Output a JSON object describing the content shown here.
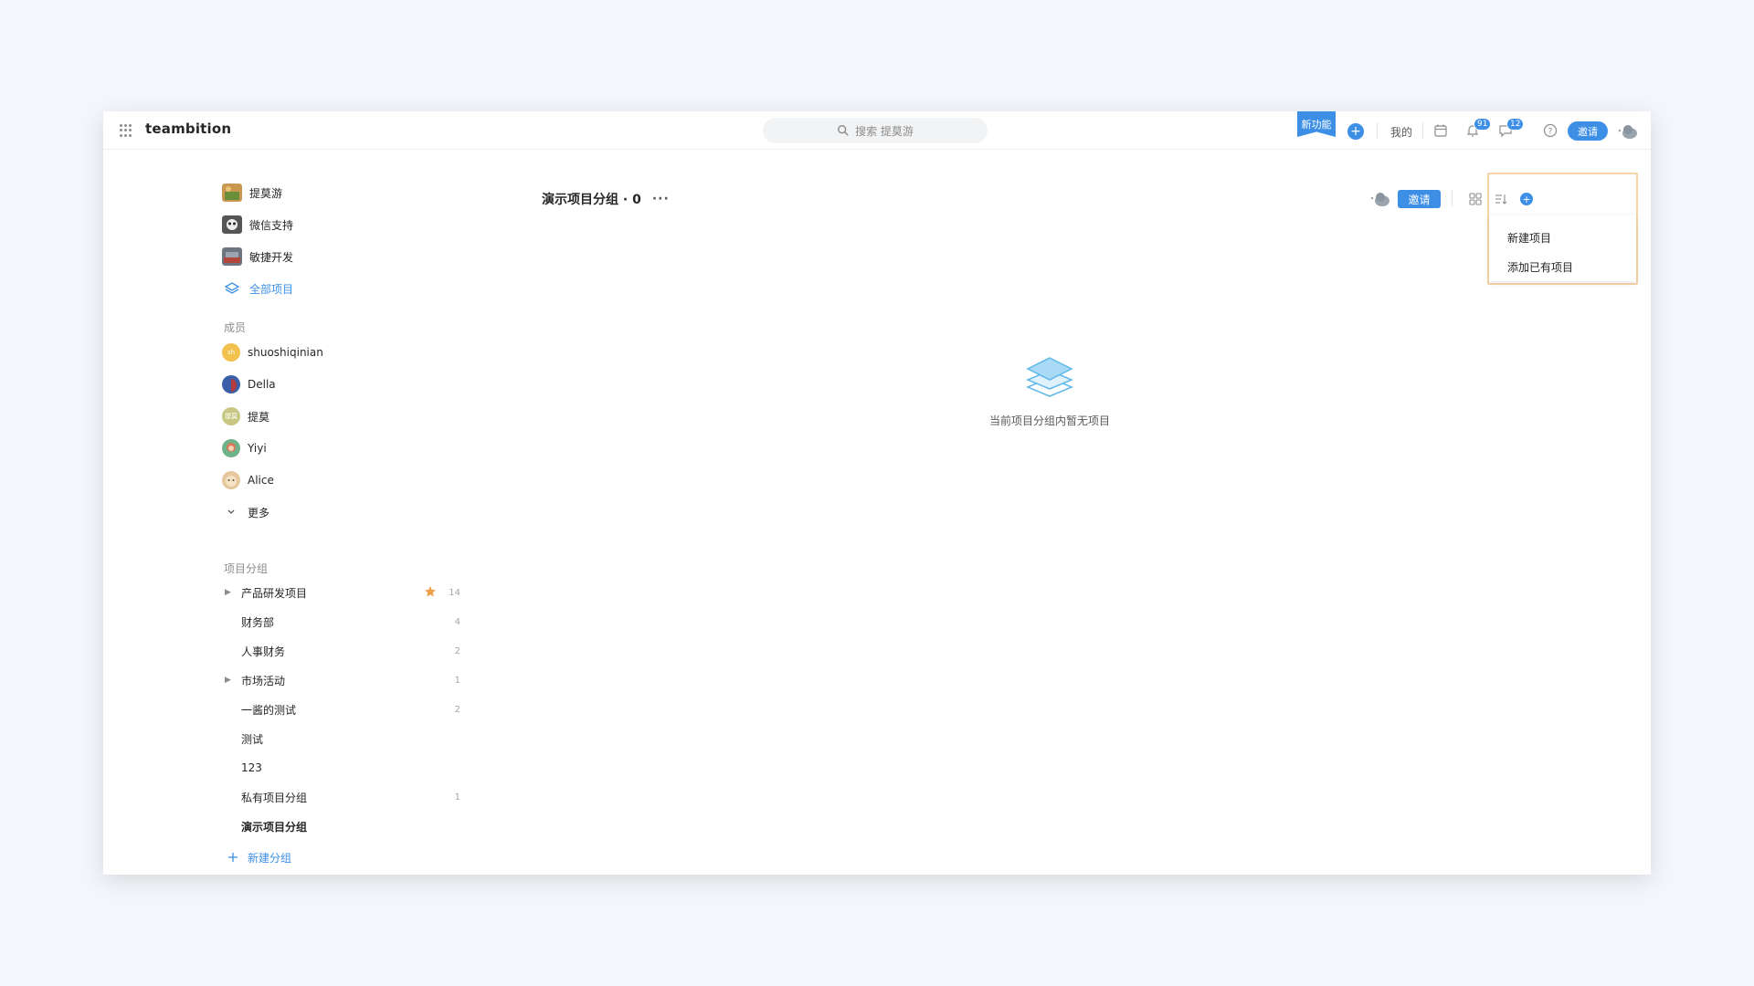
{
  "app": {
    "brand": "teambition",
    "search_placeholder": "搜索 提莫游",
    "new_feature": "新功能",
    "mine": "我的",
    "notification_count": "91",
    "message_count": "12",
    "invite": "邀请",
    "accent_color": "#3d8fe6"
  },
  "sidebar": {
    "projects": [
      {
        "label": "提莫游"
      },
      {
        "label": "微信支持"
      },
      {
        "label": "敏捷开发"
      }
    ],
    "all_projects": "全部项目",
    "members_title": "成员",
    "members": [
      {
        "name": "shuoshiqinian",
        "initials": "sh"
      },
      {
        "name": "Della"
      },
      {
        "name": "提莫",
        "initials": "提莫"
      },
      {
        "name": "Yiyi"
      },
      {
        "name": "Alice"
      }
    ],
    "more": "更多",
    "groups_title": "项目分组",
    "groups": [
      {
        "label": "产品研发项目",
        "count": "14"
      },
      {
        "label": "财务部",
        "count": "4"
      },
      {
        "label": "人事财务",
        "count": "2"
      },
      {
        "label": "市场活动",
        "count": "1"
      },
      {
        "label": "一酱的测试",
        "count": "2"
      },
      {
        "label": "测试",
        "count": ""
      },
      {
        "label": "123",
        "count": ""
      },
      {
        "label": "私有项目分组",
        "count": "1"
      },
      {
        "label": "演示项目分组",
        "count": ""
      }
    ],
    "new_group": "新建分组"
  },
  "main": {
    "title": "演示项目分组 · 0",
    "more": "···",
    "invite": "邀请",
    "dropdown": {
      "new_project": "新建项目",
      "add_existing": "添加已有项目"
    },
    "empty_text": "当前项目分组内暂无项目"
  }
}
